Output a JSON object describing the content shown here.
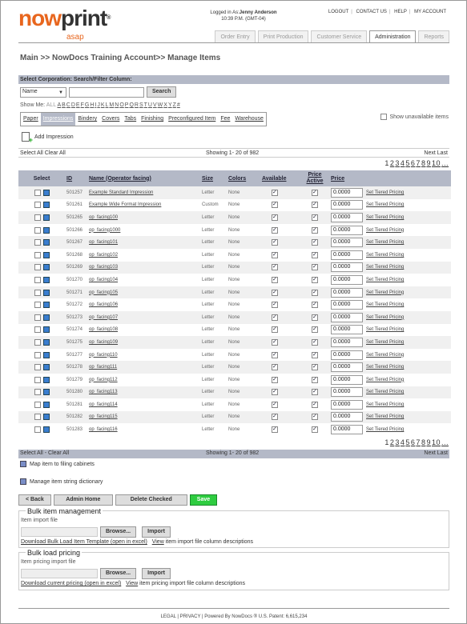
{
  "header": {
    "logo_main": "nowprint",
    "logo_sub": "asap",
    "logged_in_label": "Logged in As:",
    "user": "Jenny Anderson",
    "time": "10:39 P.M. (GMT-04)",
    "links": [
      "LOGOUT",
      "CONTACT US",
      "HELP",
      "MY ACCOUNT"
    ],
    "tabs": [
      "Order Entry",
      "Print Production",
      "Customer Service",
      "Administration",
      "Reports"
    ],
    "active_tab": "Administration"
  },
  "breadcrumb": "Main >> NowDocs Training Account>> Manage Items",
  "filter": {
    "bar_label": "Select Corporation: Search/Filter Column:",
    "column_value": "Name",
    "search_label": "Search",
    "showme_label": "Show Me:",
    "showme_all": "ALL",
    "letters": [
      "A",
      "B",
      "C",
      "D",
      "E",
      "F",
      "G",
      "H",
      "I",
      "J",
      "K",
      "L",
      "M",
      "N",
      "O",
      "P",
      "Q",
      "R",
      "S",
      "T",
      "U",
      "V",
      "W",
      "X",
      "Y",
      "Z",
      "#"
    ]
  },
  "category_tabs": [
    "Paper",
    "Impressions",
    "Bindery",
    "Covers",
    "Tabs",
    "Finishing",
    "Preconfigured Item",
    "Fee",
    "Warehouse"
  ],
  "active_category": "Impressions",
  "show_unavailable_label": "Show unavailable items",
  "add_label": "Add Impression",
  "list_bar": {
    "left": "Select All  Clear All",
    "center": "Showing 1- 20 of 982",
    "right": "Next  Last"
  },
  "pages": [
    "1",
    "2",
    "3",
    "4",
    "5",
    "6",
    "7",
    "8",
    "9",
    "10",
    "..."
  ],
  "columns": [
    "Select",
    "ID",
    "Name (Operator facing)",
    "Size",
    "Colors",
    "Available",
    "Price Active",
    "Price"
  ],
  "tier_label": "Set Tiered Pricing",
  "rows": [
    {
      "id": "501257",
      "name": "Example Standard Impression",
      "size": "Letter",
      "colors": "None",
      "price": "0.0000"
    },
    {
      "id": "501261",
      "name": "Example Wide Format Impression",
      "size": "Custom",
      "colors": "None",
      "price": "0.0000"
    },
    {
      "id": "501265",
      "name": "op_facing100",
      "size": "Letter",
      "colors": "None",
      "price": "0.0000"
    },
    {
      "id": "501266",
      "name": "op_facing1000",
      "size": "Letter",
      "colors": "None",
      "price": "0.0000"
    },
    {
      "id": "501267",
      "name": "op_facing101",
      "size": "Letter",
      "colors": "None",
      "price": "0.0000"
    },
    {
      "id": "501268",
      "name": "op_facing102",
      "size": "Letter",
      "colors": "None",
      "price": "0.0000"
    },
    {
      "id": "501269",
      "name": "op_facing103",
      "size": "Letter",
      "colors": "None",
      "price": "0.0000"
    },
    {
      "id": "501270",
      "name": "op_facing104",
      "size": "Letter",
      "colors": "None",
      "price": "0.0000"
    },
    {
      "id": "501271",
      "name": "op_facing105",
      "size": "Letter",
      "colors": "None",
      "price": "0.0000"
    },
    {
      "id": "501272",
      "name": "op_facing106",
      "size": "Letter",
      "colors": "None",
      "price": "0.0000"
    },
    {
      "id": "501273",
      "name": "op_facing107",
      "size": "Letter",
      "colors": "None",
      "price": "0.0000"
    },
    {
      "id": "501274",
      "name": "op_facing108",
      "size": "Letter",
      "colors": "None",
      "price": "0.0000"
    },
    {
      "id": "501275",
      "name": "op_facing109",
      "size": "Letter",
      "colors": "None",
      "price": "0.0000"
    },
    {
      "id": "501277",
      "name": "op_facing110",
      "size": "Letter",
      "colors": "None",
      "price": "0.0000"
    },
    {
      "id": "501278",
      "name": "op_facing111",
      "size": "Letter",
      "colors": "None",
      "price": "0.0000"
    },
    {
      "id": "501279",
      "name": "op_facing112",
      "size": "Letter",
      "colors": "None",
      "price": "0.0000"
    },
    {
      "id": "501280",
      "name": "op_facing113",
      "size": "Letter",
      "colors": "None",
      "price": "0.0000"
    },
    {
      "id": "501281",
      "name": "op_facing114",
      "size": "Letter",
      "colors": "None",
      "price": "0.0000"
    },
    {
      "id": "501282",
      "name": "op_facing115",
      "size": "Letter",
      "colors": "None",
      "price": "0.0000"
    },
    {
      "id": "501283",
      "name": "op_facing116",
      "size": "Letter",
      "colors": "None",
      "price": "0.0000"
    }
  ],
  "bottom_bar": {
    "left": "Select All  - Clear All",
    "center": "Showing 1- 20 of 982",
    "right": "Next  Last"
  },
  "map_label": "Map item to filing cabinets",
  "dictionary_label": "Manage item string dictionary",
  "buttons": {
    "back": "< Back",
    "admin_home": "Admin Home",
    "delete": "Delete Checked",
    "save": "Save"
  },
  "bulk_item": {
    "title": "Bulk item management",
    "file_label": "Item import file",
    "browse": "Browse...",
    "import": "Import",
    "download_link": "Download Bulk Load Item Template (open in excel)",
    "view_link": "View",
    "view_text": "item import file column descriptions"
  },
  "bulk_pricing": {
    "title": "Bulk load pricing",
    "file_label": "Item pricing import file",
    "browse": "Browse...",
    "import": "Import",
    "download_link": "Download current pricing (open in excel)",
    "view_link": "View",
    "view_text": "item pricing import file column descriptions"
  },
  "footer": "LEGAL  | PRIVACY  | Powered By NowDocs ® U.S. Patent: 6,615,234",
  "colors": {
    "accent": "#e8661e",
    "bar": "#b4b9c7",
    "save": "#2ecc40"
  }
}
